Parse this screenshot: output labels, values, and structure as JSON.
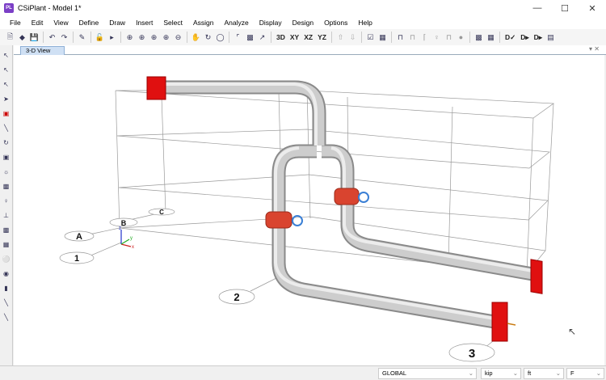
{
  "window": {
    "title": "CSiPlant - Model 1*",
    "app_icon": "PL",
    "controls": [
      "minimize",
      "maximize",
      "close"
    ]
  },
  "menu": [
    "File",
    "Edit",
    "View",
    "Define",
    "Draw",
    "Insert",
    "Select",
    "Assign",
    "Analyze",
    "Display",
    "Design",
    "Options",
    "Help"
  ],
  "toolbar": {
    "view_buttons": [
      "3D",
      "XY",
      "XZ",
      "YZ"
    ],
    "design_buttons": [
      "D✓",
      "D▸",
      "D▸"
    ]
  },
  "tab": {
    "label": "3-D View"
  },
  "grid_labels": {
    "a": "A",
    "b": "B",
    "c": "C",
    "n1": "1",
    "n2": "2",
    "n3": "3"
  },
  "axes": {
    "x": "x",
    "y": "y",
    "z": "z"
  },
  "status": {
    "coord_system": "GLOBAL",
    "force_unit": "kip",
    "length_unit": "ft",
    "temp_unit": "F"
  },
  "colors": {
    "pipe": "#c8c8c8",
    "flange": "#e01010",
    "valve": "#d9442f",
    "handwheel": "#3a7fd5",
    "accent": "#7b3fc6"
  }
}
